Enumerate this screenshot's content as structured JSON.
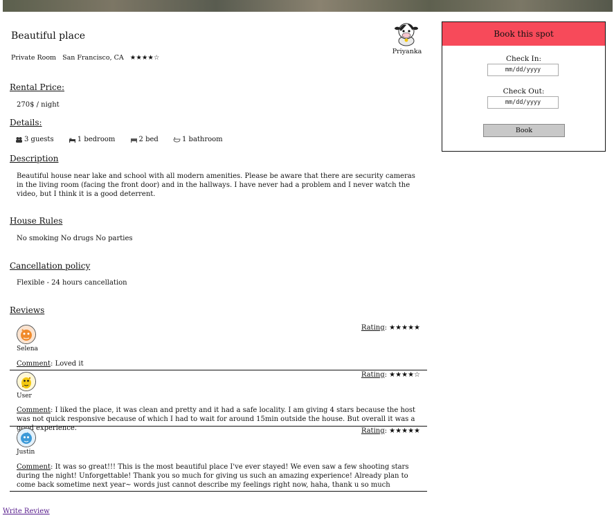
{
  "listing": {
    "title": "Beautiful place",
    "room_type": "Private Room",
    "location": "San Francisco, CA",
    "stars": "★★★★☆",
    "host_name": "Priyanka"
  },
  "rental": {
    "heading": "Rental Price",
    "colon": ":",
    "price": "270$ / night"
  },
  "details": {
    "heading": "Details",
    "colon": ":",
    "guests": "3 guests",
    "bedrooms": "1 bedroom",
    "beds": "2 bed",
    "bathrooms": "1 bathroom"
  },
  "description": {
    "heading": "Description",
    "text": "Beautiful house near lake and school with all modern amenities. Please be aware that there are security cameras in the living room (facing the front door) and in the hallways. I have never had a problem and I never watch the video, but I think it is a good deterrent."
  },
  "house_rules": {
    "heading": "House Rules",
    "text": "No smoking No drugs No parties"
  },
  "cancellation": {
    "heading": "Cancellation policy",
    "text": "Flexible - 24 hours cancellation"
  },
  "reviews": {
    "heading": "Reviews",
    "rating_label": "Rating",
    "comment_label": "Comment",
    "items": [
      {
        "user": "Selena",
        "rating": "★★★★★",
        "comment": "Loved it"
      },
      {
        "user": "User",
        "rating": "★★★★☆",
        "comment": "I liked the place, it was clean and pretty and it had a safe locality. I am giving 4 stars because the host was not quick responsive because of which I had to wait for around 15min outside the house. But overall it was a good experience."
      },
      {
        "user": "Justin",
        "rating": "★★★★★",
        "comment": "It was so great!!! This is the most beautiful place I've ever stayed! We even saw a few shooting stars during the night! Unforgettable! Thank you so much for giving us such an amazing experience! Already plan to come back sometime next year~ words just cannot describe my feelings right now, haha, thank u so much"
      }
    ],
    "write_review": "Write Review"
  },
  "booking": {
    "heading": "Book this spot",
    "check_in_label": "Check In:",
    "check_in_placeholder": "mm/dd/yyyy",
    "check_out_label": "Check Out:",
    "check_out_placeholder": "mm/dd/yyyy",
    "button": "Book",
    "accent_color": "#f74a5a"
  }
}
